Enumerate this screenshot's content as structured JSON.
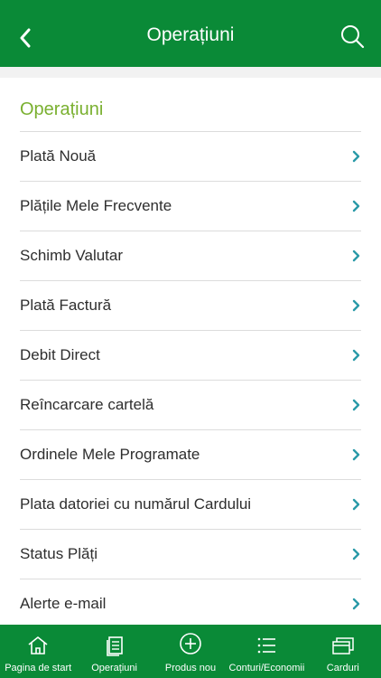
{
  "header": {
    "title": "Operațiuni"
  },
  "section": {
    "title": "Operațiuni"
  },
  "items": [
    {
      "label": "Plată Nouă"
    },
    {
      "label": "Plățile Mele Frecvente"
    },
    {
      "label": "Schimb Valutar"
    },
    {
      "label": "Plată Factură"
    },
    {
      "label": "Debit Direct"
    },
    {
      "label": "Reîncarcare cartelă"
    },
    {
      "label": "Ordinele Mele Programate"
    },
    {
      "label": "Plata datoriei cu numărul Cardului"
    },
    {
      "label": "Status Plăți"
    },
    {
      "label": "Alerte e-mail"
    }
  ],
  "tabs": [
    {
      "label": "Pagina de start",
      "icon": "home-icon"
    },
    {
      "label": "Operațiuni",
      "icon": "document-icon"
    },
    {
      "label": "Produs nou",
      "icon": "plus-circle-icon"
    },
    {
      "label": "Conturi/Economii",
      "icon": "list-icon"
    },
    {
      "label": "Carduri",
      "icon": "cards-icon"
    }
  ],
  "colors": {
    "brand": "#0a8a37",
    "accent": "#7ab030",
    "chevron": "#2a9aa8"
  }
}
